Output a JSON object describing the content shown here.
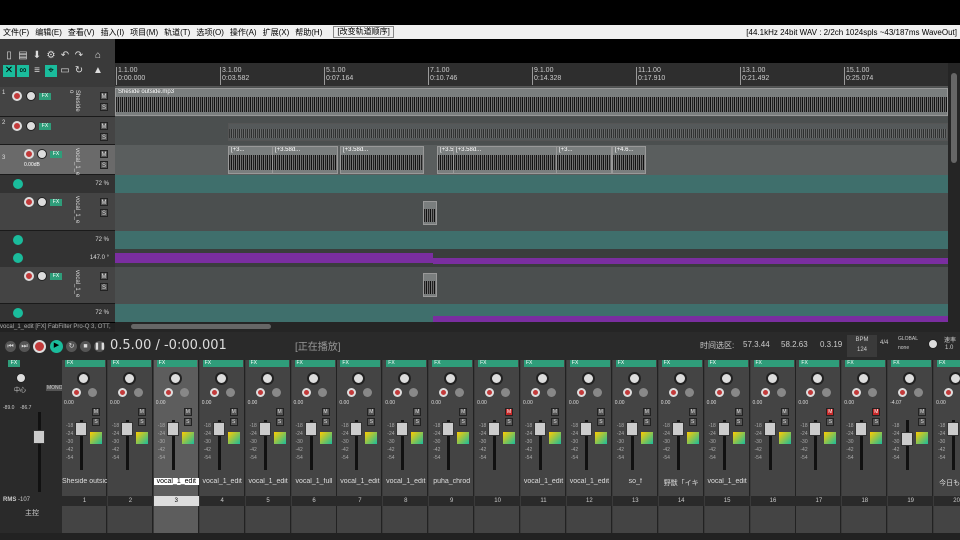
{
  "menu": {
    "items": [
      "文件(F)",
      "编辑(E)",
      "查看(V)",
      "插入(I)",
      "项目(M)",
      "轨道(T)",
      "选项(O)",
      "操作(A)",
      "扩展(X)",
      "帮助(H)"
    ],
    "action": "[改变轨道顺序]",
    "status": "[44.1kHz 24bit WAV : 2/2ch 1024spls ~43/187ms WaveOut]"
  },
  "ruler": {
    "marks": [
      {
        "bar": "1.1.00",
        "time": "0:00.000"
      },
      {
        "bar": "3.1.00",
        "time": "0:03.582"
      },
      {
        "bar": "5.1.00",
        "time": "0:07.164"
      },
      {
        "bar": "7.1.00",
        "time": "0:10.746"
      },
      {
        "bar": "9.1.00",
        "time": "0:14.328"
      },
      {
        "bar": "11.1.00",
        "time": "0:17.910"
      },
      {
        "bar": "13.1.00",
        "time": "0:21.492"
      },
      {
        "bar": "15.1.00",
        "time": "0:25.074"
      }
    ]
  },
  "tracks": [
    {
      "num": "1",
      "name": "Sheside o",
      "volume": ""
    },
    {
      "num": "2",
      "name": "",
      "volume": ""
    },
    {
      "num": "3",
      "name": "vocal_1_e",
      "volume": "0.00dB"
    },
    {
      "num": "",
      "name": "vocal_1_e",
      "volume": ""
    },
    {
      "num": "",
      "name": "vocal_1_e",
      "volume": ""
    }
  ],
  "envelopes": [
    {
      "value": "72 %"
    },
    {
      "value": "72 %"
    },
    {
      "value": "147.0 °"
    },
    {
      "value": "72 %"
    }
  ],
  "items": {
    "sheside": "Sheside outside.mp3",
    "clip_labels": [
      "[+3...",
      "[+3.58d...",
      "[+3.58d...",
      "[+3.58",
      "[+3.58d...",
      "[+3...",
      "[+4.6..."
    ]
  },
  "fx_chain_label": "vocal_1_edit [FX] FabFilter Pro-Q 3, OTT,",
  "transport": {
    "position": "0.5.00 / -0:00.001",
    "state": "[正在播放]",
    "selection_label": "时间选区:",
    "sel_start": "57.3.44",
    "sel_end": "58.2.63",
    "sel_len": "0.3.19",
    "bpm_label": "BPM",
    "bpm": "124",
    "timesig": "4/4",
    "global": "GLOBAL",
    "global_mode": "none",
    "rate_label": "速率",
    "rate": "1.0"
  },
  "master": {
    "label": "中心",
    "mono": "MONO",
    "peak_l": "-89.0",
    "peak_r": "-86.7",
    "rms_label": "RMS",
    "rms": "-107",
    "name": "主控"
  },
  "strips": [
    {
      "name": "Sheside outsic",
      "num": "1",
      "vol": "0.00",
      "muted": false,
      "selected": false
    },
    {
      "name": "",
      "num": "2",
      "vol": "0.00",
      "muted": false,
      "selected": false
    },
    {
      "name": "vocal_1_edit",
      "num": "3",
      "vol": "0.00",
      "muted": false,
      "selected": true
    },
    {
      "name": "vocal_1_edit",
      "num": "4",
      "vol": "0.00",
      "muted": false,
      "selected": false
    },
    {
      "name": "vocal_1_edit",
      "num": "5",
      "vol": "0.00",
      "muted": false,
      "selected": false
    },
    {
      "name": "vocal_1_full",
      "num": "6",
      "vol": "0.00",
      "muted": false,
      "selected": false
    },
    {
      "name": "vocal_1_edit",
      "num": "7",
      "vol": "0.00",
      "muted": false,
      "selected": false
    },
    {
      "name": "vocal_1_edit",
      "num": "8",
      "vol": "0.00",
      "muted": false,
      "selected": false
    },
    {
      "name": "puha_chrod",
      "num": "9",
      "vol": "0.00",
      "muted": false,
      "selected": false
    },
    {
      "name": "",
      "num": "10",
      "vol": "0.00",
      "muted": true,
      "selected": false
    },
    {
      "name": "vocal_1_edit",
      "num": "11",
      "vol": "0.00",
      "muted": false,
      "selected": false
    },
    {
      "name": "vocal_1_edit",
      "num": "12",
      "vol": "0.00",
      "muted": false,
      "selected": false
    },
    {
      "name": "so_f",
      "num": "13",
      "vol": "0.00",
      "muted": false,
      "selected": false
    },
    {
      "name": "野獣「イキ",
      "num": "14",
      "vol": "0.00",
      "muted": false,
      "selected": false
    },
    {
      "name": "vocal_1_edit",
      "num": "15",
      "vol": "0.00",
      "muted": false,
      "selected": false
    },
    {
      "name": "",
      "num": "16",
      "vol": "0.00",
      "muted": false,
      "selected": false
    },
    {
      "name": "",
      "num": "17",
      "vol": "0.00",
      "muted": true,
      "selected": false
    },
    {
      "name": "",
      "num": "18",
      "vol": "0.00",
      "muted": true,
      "selected": false
    },
    {
      "name": "",
      "num": "19",
      "vol": "-4.07",
      "muted": false,
      "selected": false
    },
    {
      "name": "今日もいい",
      "num": "20",
      "vol": "0.00",
      "muted": true,
      "selected": false
    }
  ],
  "strip_labels": {
    "fx": "FX",
    "route": "route",
    "trim": "trim",
    "mute": "M",
    "solo": "S"
  },
  "colors": {
    "accent": "#2f9d7a",
    "record": "#c23a3a",
    "envelope": "#2e6e6a",
    "pitch": "#7a2ea0",
    "mute": "#c62828"
  }
}
